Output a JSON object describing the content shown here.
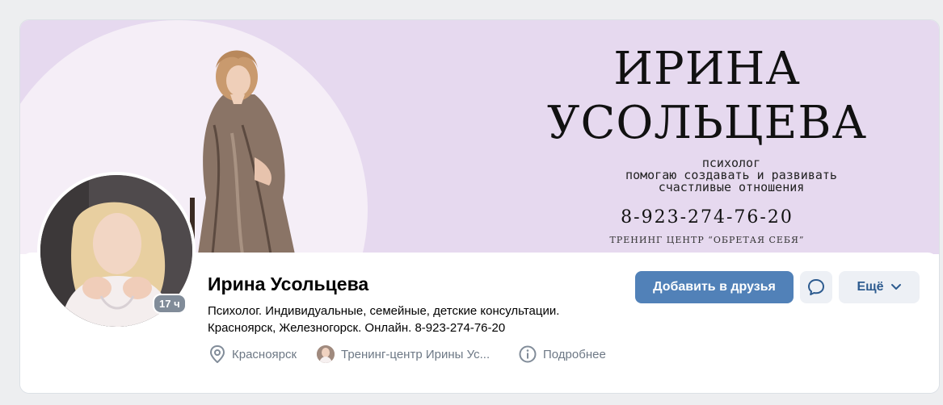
{
  "cover": {
    "title_line1": "ИРИНА",
    "title_line2": "УСОЛЬЦЕВА",
    "tagline1": "психолог",
    "tagline2": "помогаю создавать и развивать",
    "tagline3": "счастливые отношения",
    "phone": "8-923-274-76-20",
    "center": "ТРЕНИНГ ЦЕНТР “ОБРЕТАЯ СЕБЯ”"
  },
  "profile": {
    "name": "Ирина Усольцева",
    "status_line1": "Психолог. Индивидуальные, семейные, детские консультации.",
    "status_line2": "Красноярск, Железногорск. Онлайн. 8-923-274-76-20",
    "online_badge": "17 ч"
  },
  "info": {
    "city": "Красноярск",
    "work": "Тренинг-центр Ирины Ус...",
    "details": "Подробнее"
  },
  "actions": {
    "add_friend": "Добавить в друзья",
    "more": "Ещё"
  },
  "icons": {
    "location": "location-pin-icon",
    "message": "message-bubble-icon",
    "info": "info-circle-icon",
    "chevron": "chevron-down-icon"
  },
  "colors": {
    "primary_button": "#5181b8",
    "secondary_button": "#edf0f5",
    "secondary_text": "#2d5b8f",
    "muted_text": "#6d7885",
    "cover_bg": "#e6d9ef"
  }
}
